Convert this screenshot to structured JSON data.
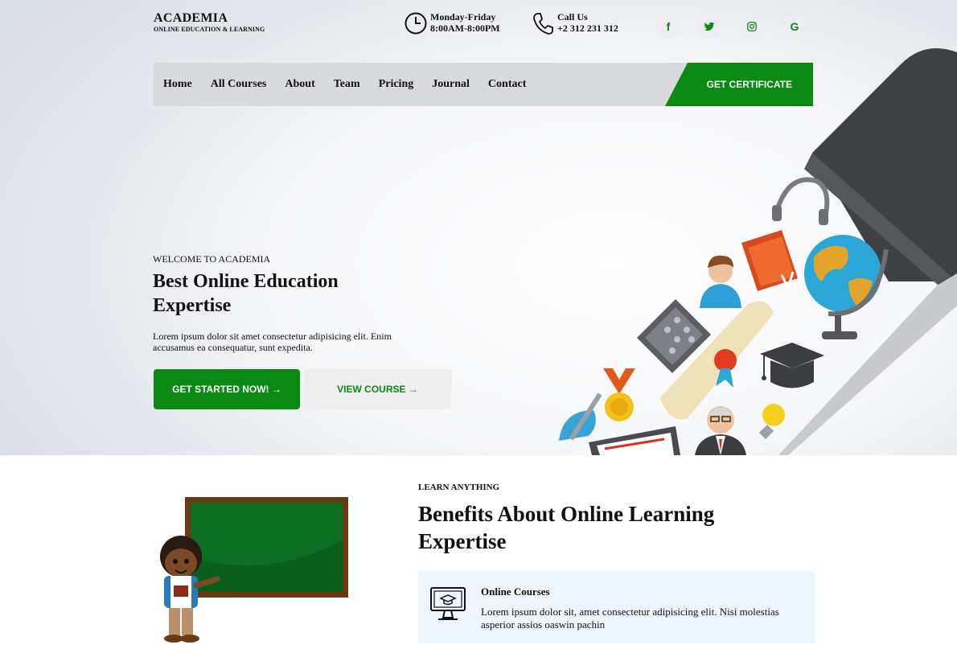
{
  "brand": {
    "name": "ACADEMIA",
    "tagline": "ONLINE EDUCATION & LEARNING"
  },
  "header": {
    "hours_title": "Monday-Friday",
    "hours_value": "8:00AM-8:00PM",
    "phone_title": "Call Us",
    "phone_value": "+2 312 231 312",
    "social": [
      {
        "icon": "facebook-icon",
        "glyph": "f"
      },
      {
        "icon": "twitter-icon"
      },
      {
        "icon": "instagram-icon"
      },
      {
        "icon": "google-icon",
        "glyph": "G"
      }
    ]
  },
  "nav": {
    "items": [
      "Home",
      "All Courses",
      "About",
      "Team",
      "Pricing",
      "Journal",
      "Contact"
    ],
    "cta": "GET CERTIFICATE"
  },
  "hero": {
    "eyebrow": "WELCOME TO ACADEMIA",
    "title": "Best Online Education Expertise",
    "text": "Lorem ipsum dolor sit amet consectetur adipisicing elit. Enim accusamus ea consequatur, sunt expedita.",
    "primary_button": "GET STARTED NOW! →",
    "secondary_button": "VIEW COURSE →"
  },
  "benefits": {
    "eyebrow": "LEARN ANYTHING",
    "title": "Benefits About Online Learning Expertise",
    "feature": {
      "icon": "online-course-monitor-icon",
      "title": "Online Courses",
      "text": "Lorem ipsum dolor sit, amet consectetur adipisicing elit. Nisi molestias asperior assios oaswin pachin"
    }
  },
  "colors": {
    "accent": "#0a8a12",
    "nav_bg": "#d9dadd",
    "feature_bg": "#eef6fe"
  }
}
